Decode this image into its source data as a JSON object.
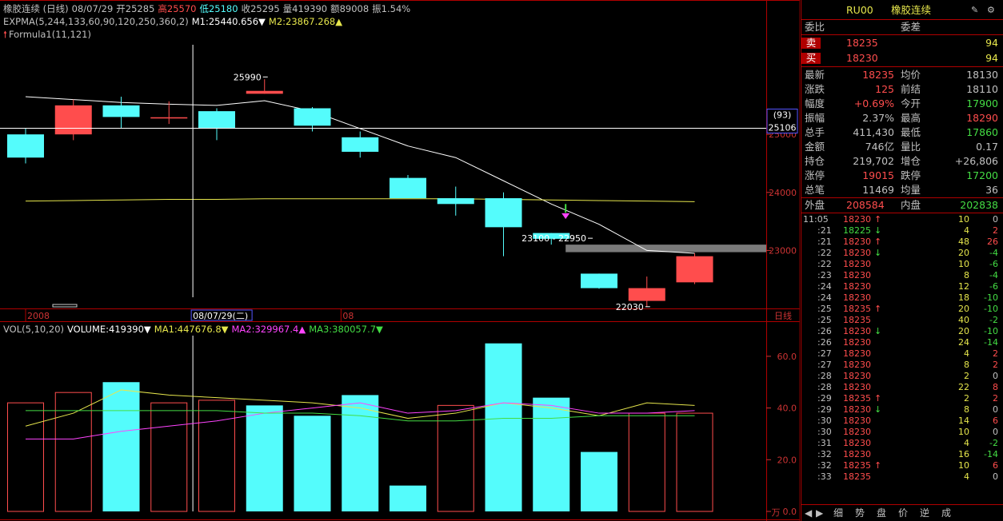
{
  "colors": {
    "up": "#ff4d4d",
    "down": "#54fcfc",
    "ma_white": "#ffffff",
    "ma_yellow": "#e6e64c",
    "ma_magenta": "#ff44ff",
    "ma_green": "#44dd44",
    "grid": "#b00000",
    "label": "#cc3333"
  },
  "header": {
    "line1": [
      {
        "text": "橡胶连续 (日线)",
        "color": "#c0c0c0"
      },
      {
        "text": "08/07/29",
        "color": "#c0c0c0"
      },
      {
        "text": "开25285",
        "color": "#c0c0c0"
      },
      {
        "text": "高25570",
        "color": "#ff4d4d"
      },
      {
        "text": "低25180",
        "color": "#54fcfc"
      },
      {
        "text": "收25295",
        "color": "#c0c0c0"
      },
      {
        "text": "量419390",
        "color": "#c0c0c0"
      },
      {
        "text": "额89008",
        "color": "#c0c0c0"
      },
      {
        "text": "振1.54%",
        "color": "#c0c0c0"
      }
    ],
    "line2": [
      {
        "text": "EXPMA(5,244,133,60,90,120,250,360,2)",
        "color": "#c0c0c0"
      },
      {
        "text": "M1:25440.656▼",
        "color": "#ffffff"
      },
      {
        "text": "M2:23867.268▲",
        "color": "#e6e64c"
      }
    ],
    "line3": [
      {
        "text": "Formula1(11,121)",
        "color": "#c0c0c0"
      }
    ],
    "vol": [
      {
        "text": "VOL(5,10,20)",
        "color": "#c0c0c0"
      },
      {
        "text": "VOLUME:419390▼",
        "color": "#ffffff"
      },
      {
        "text": "MA1:447676.8▼",
        "color": "#e6e64c"
      },
      {
        "text": "MA2:329967.4▲",
        "color": "#ff44ff"
      },
      {
        "text": "MA3:380057.7▼",
        "color": "#44dd44"
      }
    ]
  },
  "chart_data": [
    {
      "type": "candlestick",
      "ylim": [
        22000,
        26600
      ],
      "yticks": [
        {
          "v": 25000,
          "label": "25000"
        },
        {
          "v": 24000,
          "label": "24000"
        },
        {
          "v": 23000,
          "label": "23000"
        }
      ],
      "xlabels": [
        {
          "i": 0,
          "label": "2008"
        },
        {
          "i": 6.6,
          "label": "08"
        }
      ],
      "cursor": {
        "i": 3.5,
        "date": "08/07/29(二)"
      },
      "crosshair_price": {
        "top": "(93)",
        "bottom": "25106",
        "value": 25106
      },
      "candles": [
        {
          "o": 25000,
          "h": 25100,
          "l": 24500,
          "c": 24600
        },
        {
          "o": 25000,
          "h": 25600,
          "l": 24900,
          "c": 25500
        },
        {
          "o": 25500,
          "h": 25650,
          "l": 25100,
          "c": 25300
        },
        {
          "o": 25290,
          "h": 25570,
          "l": 25180,
          "c": 25295
        },
        {
          "o": 25400,
          "h": 25450,
          "l": 24900,
          "c": 25100
        },
        {
          "o": 25700,
          "h": 25950,
          "l": 25700,
          "c": 25750
        },
        {
          "o": 25450,
          "h": 25470,
          "l": 25050,
          "c": 25150
        },
        {
          "o": 24950,
          "h": 25050,
          "l": 24600,
          "c": 24700
        },
        {
          "o": 24250,
          "h": 24300,
          "l": 23900,
          "c": 23900
        },
        {
          "o": 23900,
          "h": 24100,
          "l": 23600,
          "c": 23800
        },
        {
          "o": 23900,
          "h": 24000,
          "l": 22900,
          "c": 23400
        },
        {
          "o": 23300,
          "h": 23300,
          "l": 23100,
          "c": 23200
        },
        {
          "o": 22600,
          "h": 22600,
          "l": 22340,
          "c": 22350
        },
        {
          "o": 22130,
          "h": 22550,
          "l": 22030,
          "c": 22350
        },
        {
          "o": 22450,
          "h": 22950,
          "l": 22420,
          "c": 22900
        }
      ],
      "ma_white": [
        25650,
        25600,
        25550,
        25520,
        25500,
        25580,
        25400,
        25100,
        24800,
        24600,
        24200,
        23800,
        23450,
        23000,
        22950
      ],
      "ma_yellow": [
        23850,
        23860,
        23870,
        23880,
        23880,
        23890,
        23890,
        23890,
        23890,
        23890,
        23880,
        23870,
        23860,
        23850,
        23840
      ],
      "annotations": [
        {
          "i": 5,
          "v": 25990,
          "text": "25990"
        },
        {
          "i": 13,
          "v": 22030,
          "text": "22030"
        },
        {
          "i": 11.8,
          "v": 23210,
          "text": "23100 - 22950"
        }
      ],
      "zone": {
        "from_i": 11.3,
        "v_top": 23100,
        "v_bottom": 22970
      }
    },
    {
      "type": "bar",
      "title": "VOL(5,10,20)",
      "ylim": [
        0,
        68
      ],
      "yticks": [
        {
          "v": 60,
          "label": "60.0"
        },
        {
          "v": 40,
          "label": "40.0"
        },
        {
          "v": 20,
          "label": "20.0"
        },
        {
          "v": 0,
          "label": "0.0"
        }
      ],
      "unit_label": "万",
      "values": [
        42,
        46,
        50,
        42,
        43,
        41,
        37,
        45,
        10,
        41,
        65,
        44,
        23,
        38,
        38
      ],
      "up": [
        true,
        true,
        false,
        true,
        true,
        false,
        false,
        false,
        false,
        true,
        false,
        false,
        false,
        true,
        true
      ],
      "series": [
        {
          "values": [
            33,
            38,
            47,
            45,
            44,
            43,
            42,
            40,
            36,
            38,
            42,
            40,
            37,
            42,
            41
          ],
          "color": "#e6e64c"
        },
        {
          "values": [
            28,
            28,
            31,
            33,
            35,
            38,
            40,
            42,
            38,
            39,
            42,
            41,
            38,
            38,
            39
          ],
          "color": "#ff44ff"
        },
        {
          "values": [
            39,
            39,
            39,
            39,
            39,
            38,
            38,
            37,
            35,
            35,
            36,
            36,
            37,
            37,
            37
          ],
          "color": "#44dd44"
        }
      ]
    }
  ],
  "axis": {
    "period_label": "日线"
  },
  "panel": {
    "code": "RU00",
    "name": "橡胶连续",
    "weibi": "委比",
    "weicha": "委差",
    "sell": {
      "label": "卖",
      "price": "18235",
      "vol": "94"
    },
    "buy": {
      "label": "买",
      "price": "18230",
      "vol": "94"
    },
    "stats": [
      {
        "l1": "最新",
        "v1": "18235",
        "c1": "#ff4d4d",
        "l2": "均价",
        "v2": "18130",
        "c2": "#c0c0c0"
      },
      {
        "l1": "涨跌",
        "v1": "125",
        "c1": "#ff4d4d",
        "l2": "前结",
        "v2": "18110",
        "c2": "#c0c0c0"
      },
      {
        "l1": "幅度",
        "v1": "+0.69%",
        "c1": "#ff4d4d",
        "l2": "今开",
        "v2": "17900",
        "c2": "#44dd44"
      },
      {
        "l1": "振幅",
        "v1": "2.37%",
        "c1": "#c0c0c0",
        "l2": "最高",
        "v2": "18290",
        "c2": "#ff4d4d"
      },
      {
        "l1": "总手",
        "v1": "411,430",
        "c1": "#c0c0c0",
        "l2": "最低",
        "v2": "17860",
        "c2": "#44dd44"
      },
      {
        "l1": "金额",
        "v1": "746亿",
        "c1": "#c0c0c0",
        "l2": "量比",
        "v2": "0.17",
        "c2": "#c0c0c0"
      },
      {
        "l1": "持仓",
        "v1": "219,702",
        "c1": "#c0c0c0",
        "l2": "增仓",
        "v2": "+26,806",
        "c2": "#c0c0c0"
      },
      {
        "l1": "涨停",
        "v1": "19015",
        "c1": "#ff4d4d",
        "l2": "跌停",
        "v2": "17200",
        "c2": "#44dd44"
      },
      {
        "l1": "总笔",
        "v1": "11469",
        "c1": "#c0c0c0",
        "l2": "均量",
        "v2": "36",
        "c2": "#c0c0c0"
      }
    ],
    "outer": {
      "label": "外盘",
      "value": "208584"
    },
    "inner": {
      "label": "内盘",
      "value": "202838"
    },
    "ticks": [
      {
        "t": "11:05",
        "p": "18230",
        "a": "↑",
        "v": "10",
        "d": "0"
      },
      {
        "t": ":21",
        "p": "18225",
        "a": "↓",
        "v": "4",
        "d": "2"
      },
      {
        "t": ":21",
        "p": "18230",
        "a": "↑",
        "v": "48",
        "d": "26"
      },
      {
        "t": ":22",
        "p": "18230",
        "a": "↓",
        "v": "20",
        "d": "-4"
      },
      {
        "t": ":22",
        "p": "18230",
        "a": "",
        "v": "10",
        "d": "-6"
      },
      {
        "t": ":23",
        "p": "18230",
        "a": "",
        "v": "8",
        "d": "-4"
      },
      {
        "t": ":24",
        "p": "18230",
        "a": "",
        "v": "12",
        "d": "-6"
      },
      {
        "t": ":24",
        "p": "18230",
        "a": "",
        "v": "18",
        "d": "-10"
      },
      {
        "t": ":25",
        "p": "18235",
        "a": "↑",
        "v": "20",
        "d": "-10"
      },
      {
        "t": ":25",
        "p": "18235",
        "a": "",
        "v": "40",
        "d": "-2"
      },
      {
        "t": ":26",
        "p": "18230",
        "a": "↓",
        "v": "20",
        "d": "-10"
      },
      {
        "t": ":26",
        "p": "18230",
        "a": "",
        "v": "24",
        "d": "-14"
      },
      {
        "t": ":27",
        "p": "18230",
        "a": "",
        "v": "4",
        "d": "2"
      },
      {
        "t": ":27",
        "p": "18230",
        "a": "",
        "v": "8",
        "d": "2"
      },
      {
        "t": ":28",
        "p": "18230",
        "a": "",
        "v": "2",
        "d": "0"
      },
      {
        "t": ":28",
        "p": "18230",
        "a": "",
        "v": "22",
        "d": "8"
      },
      {
        "t": ":29",
        "p": "18235",
        "a": "↑",
        "v": "2",
        "d": "2"
      },
      {
        "t": ":29",
        "p": "18230",
        "a": "↓",
        "v": "8",
        "d": "0"
      },
      {
        "t": ":30",
        "p": "18230",
        "a": "",
        "v": "14",
        "d": "6"
      },
      {
        "t": ":30",
        "p": "18230",
        "a": "",
        "v": "10",
        "d": "0"
      },
      {
        "t": ":31",
        "p": "18230",
        "a": "",
        "v": "4",
        "d": "-2"
      },
      {
        "t": ":32",
        "p": "18230",
        "a": "",
        "v": "16",
        "d": "-14"
      },
      {
        "t": ":32",
        "p": "18235",
        "a": "↑",
        "v": "10",
        "d": "6"
      },
      {
        "t": ":33",
        "p": "18235",
        "a": "",
        "v": "4",
        "d": "0"
      }
    ],
    "tabs": [
      "细",
      "势",
      "盘",
      "价",
      "逆",
      "成"
    ]
  }
}
